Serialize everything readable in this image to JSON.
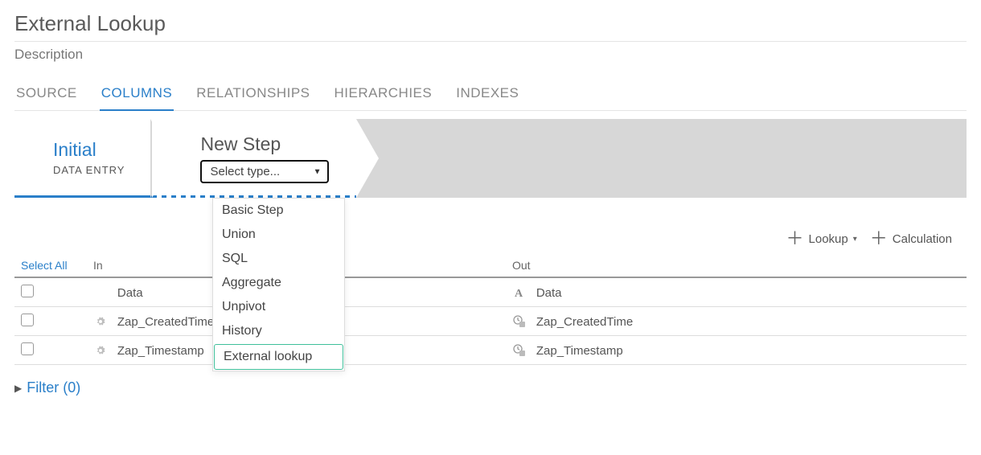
{
  "header": {
    "title": "External Lookup",
    "subtitle": "Description"
  },
  "tabs": [
    {
      "label": "SOURCE",
      "active": false
    },
    {
      "label": "COLUMNS",
      "active": true
    },
    {
      "label": "RELATIONSHIPS",
      "active": false
    },
    {
      "label": "HIERARCHIES",
      "active": false
    },
    {
      "label": "INDEXES",
      "active": false
    }
  ],
  "steps": {
    "initial": {
      "title": "Initial",
      "sub": "DATA ENTRY"
    },
    "new": {
      "title": "New Step",
      "select_placeholder": "Select type..."
    }
  },
  "type_dropdown": {
    "items": [
      {
        "label": "Basic Step",
        "highlight": false
      },
      {
        "label": "Union",
        "highlight": false
      },
      {
        "label": "SQL",
        "highlight": false
      },
      {
        "label": "Aggregate",
        "highlight": false
      },
      {
        "label": "Unpivot",
        "highlight": false
      },
      {
        "label": "History",
        "highlight": false
      },
      {
        "label": "External lookup",
        "highlight": true
      }
    ]
  },
  "toolbar": {
    "lookup_label": "Lookup",
    "calculation_label": "Calculation"
  },
  "table": {
    "select_all": "Select All",
    "in_header": "In",
    "out_header": "Out",
    "rows": [
      {
        "in_label": "Data",
        "in_icon": "blank",
        "out_label": "Data",
        "out_icon": "text-type"
      },
      {
        "in_label": "Zap_CreatedTime",
        "in_icon": "gear",
        "out_label": "Zap_CreatedTime",
        "out_icon": "datetime"
      },
      {
        "in_label": "Zap_Timestamp",
        "in_icon": "gear",
        "out_label": "Zap_Timestamp",
        "out_icon": "datetime"
      }
    ]
  },
  "filter": {
    "label": "Filter (0)"
  }
}
